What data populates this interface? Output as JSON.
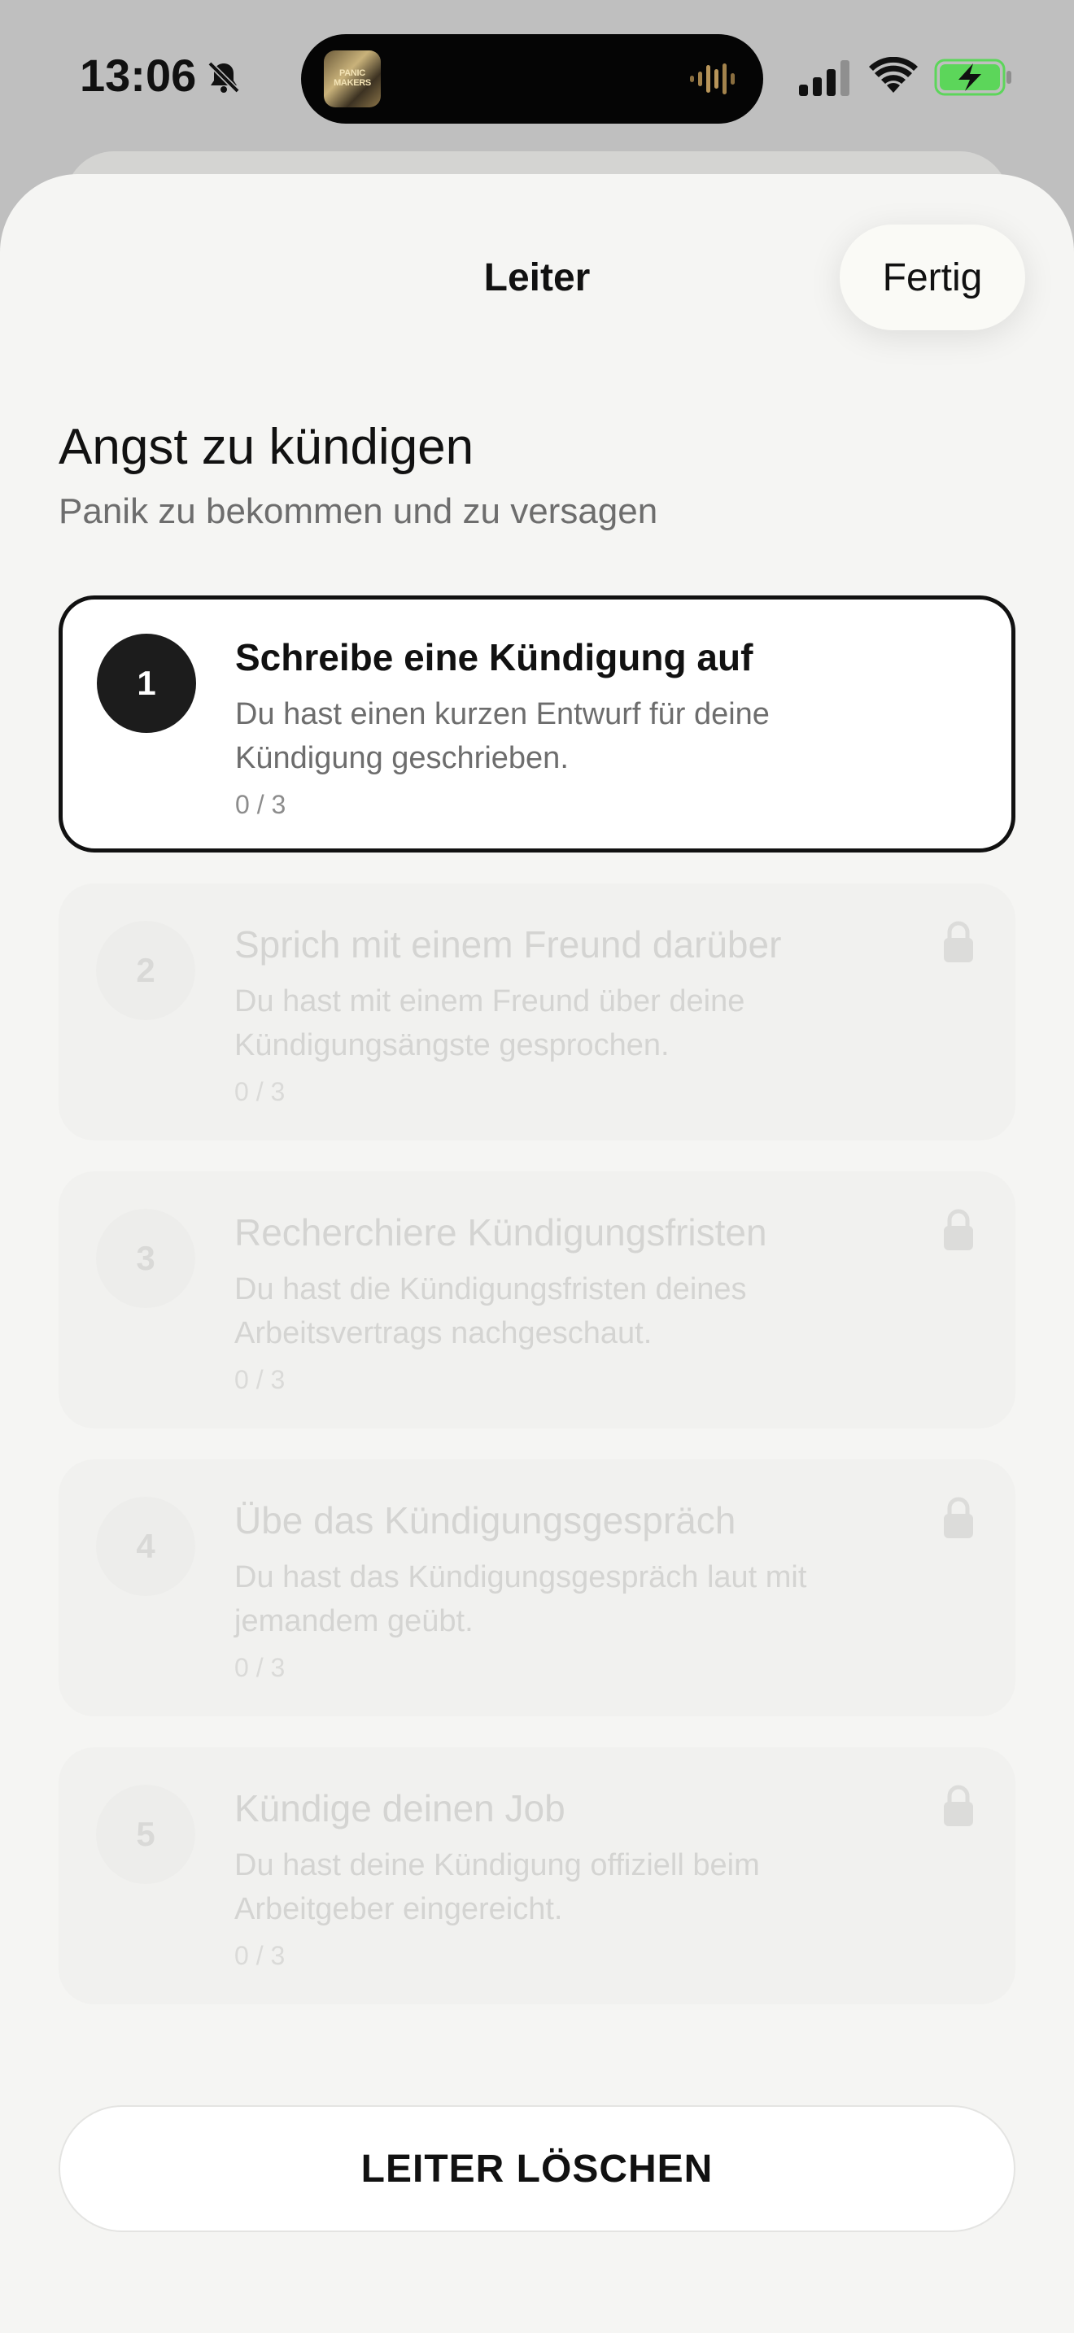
{
  "status_bar": {
    "time": "13:06",
    "island_art_text": "PANIC MAKERS"
  },
  "sheet": {
    "title": "Leiter",
    "done_label": "Fertig",
    "heading": "Angst zu kündigen",
    "subheading": "Panik zu bekommen und zu versagen",
    "delete_label": "LEITER LÖSCHEN"
  },
  "steps": [
    {
      "number": "1",
      "title": "Schreibe eine Kündigung auf",
      "description": "Du hast einen kurzen Entwurf für deine Kündigung geschrieben.",
      "progress": "0 / 3",
      "state": "active"
    },
    {
      "number": "2",
      "title": "Sprich mit einem Freund darüber",
      "description": "Du hast mit einem Freund über deine Kündigungsängste gesprochen.",
      "progress": "0 / 3",
      "state": "locked"
    },
    {
      "number": "3",
      "title": "Recherchiere Kündigungsfristen",
      "description": "Du hast die Kündigungsfristen deines Arbeitsvertrags nachgeschaut.",
      "progress": "0 / 3",
      "state": "locked"
    },
    {
      "number": "4",
      "title": "Übe das Kündigungsgespräch",
      "description": "Du hast das Kündigungsgespräch laut mit jemandem geübt.",
      "progress": "0 / 3",
      "state": "locked"
    },
    {
      "number": "5",
      "title": "Kündige deinen Job",
      "description": "Du hast deine Kündigung offiziell beim Arbeitgeber eingereicht.",
      "progress": "0 / 3",
      "state": "locked"
    }
  ],
  "icons": {
    "bell": "bell-slash-icon",
    "lock": "lock-icon",
    "signal": "signal-icon",
    "wifi": "wifi-icon",
    "battery": "battery-charging-icon"
  },
  "colors": {
    "battery_fill": "#5cd65a",
    "active_circle": "#1c1c1c",
    "locked_text": "#d4d4d2"
  }
}
